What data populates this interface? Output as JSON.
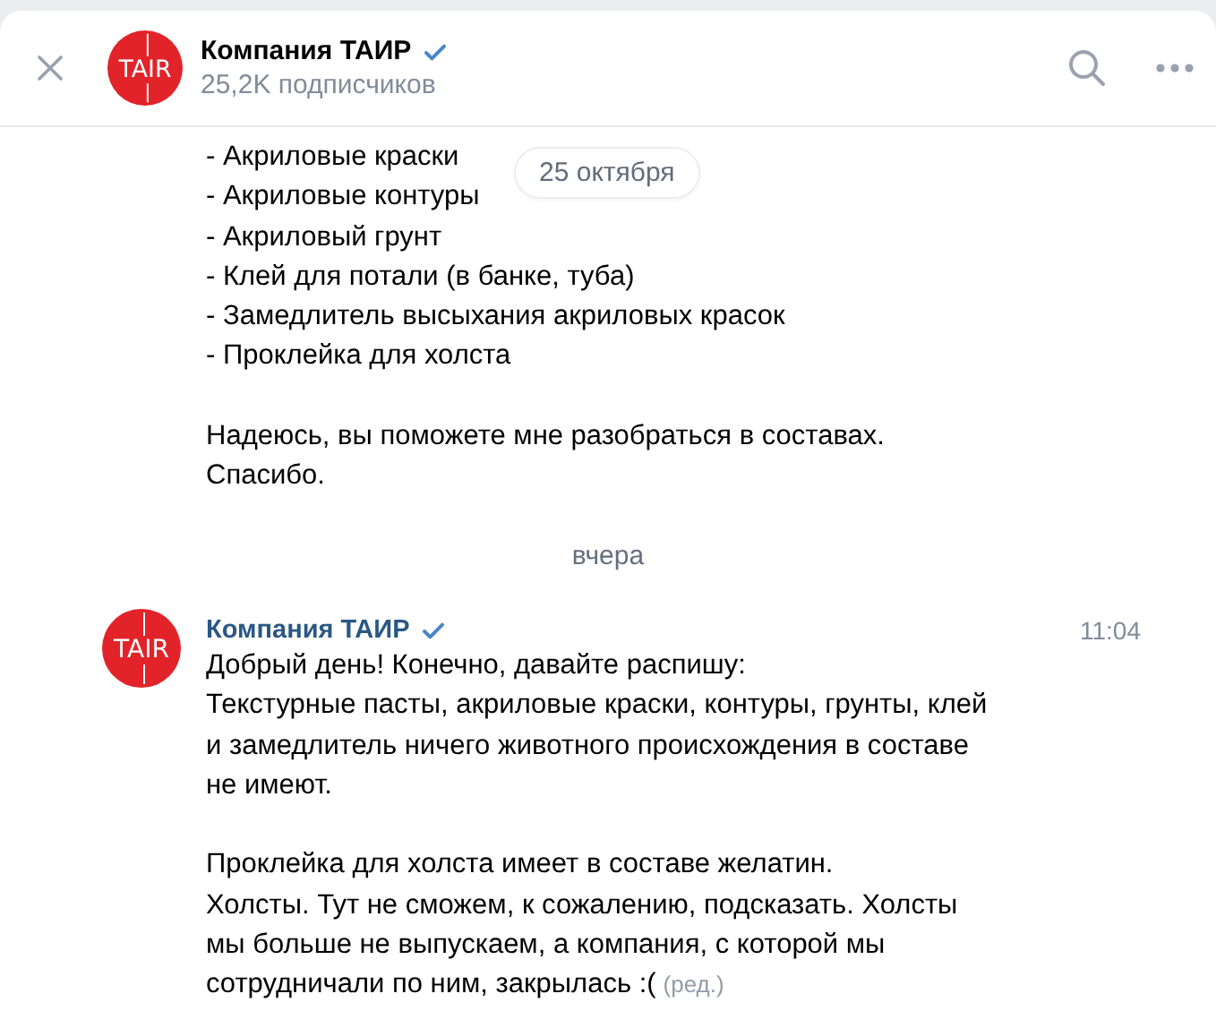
{
  "header": {
    "title": "Компания ТАИР",
    "verified": true,
    "subtitle": "25,2K подписчиков",
    "logo_text": "TAIR"
  },
  "date_pill": "25 октября",
  "messages": [
    {
      "kind": "continuation",
      "paragraphs": [
        [
          "- Акриловые краски",
          "- Акриловые контуры",
          "- Акриловый грунт",
          "- Клей для потали (в банке, туба)",
          "- Замедлитель высыхания акриловых красок",
          "- Проклейка для холста"
        ],
        [
          "Надеюсь, вы поможете мне разобраться в составах.",
          "Спасибо."
        ]
      ]
    },
    {
      "kind": "divider",
      "label": "вчера"
    },
    {
      "kind": "full",
      "author": "Компания ТАИР",
      "verified": true,
      "logo_text": "TAIR",
      "time": "11:04",
      "edited_label": "(ред.)",
      "paragraphs": [
        [
          "Добрый день! Конечно, давайте распишу:",
          "Текстурные пасты, акриловые краски, контуры, грунты, клей",
          "и замедлитель ничего животного происхождения в составе",
          "не имеют."
        ],
        [
          "Проклейка для холста имеет в составе желатин.",
          "Холсты. Тут не сможем, к сожалению, подсказать. Холсты",
          "мы больше не выпускаем, а компания, с которой мы",
          "сотрудничали по ним, закрылась :("
        ]
      ]
    }
  ]
}
